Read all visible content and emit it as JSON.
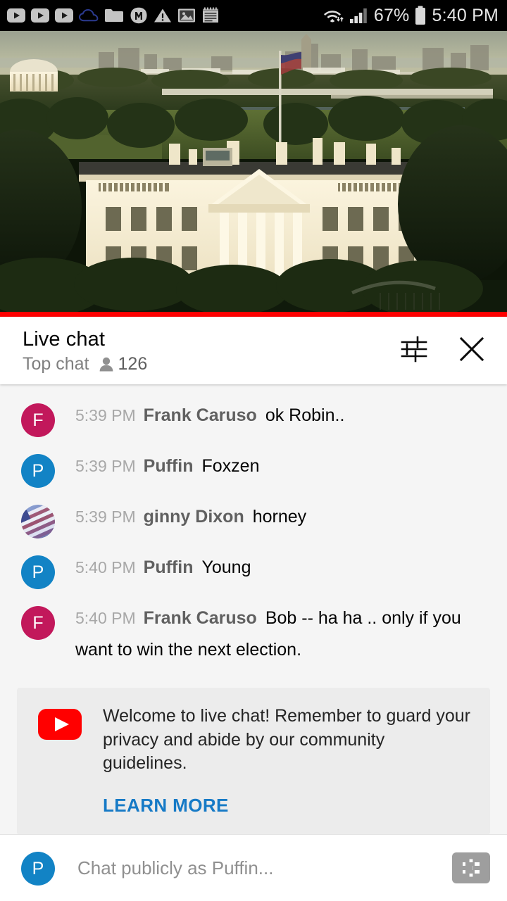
{
  "statusbar": {
    "left_icons": [
      "youtube-play-icon",
      "youtube-play-icon",
      "youtube-play-icon",
      "cloud-icon",
      "folder-icon",
      "monument-m-icon",
      "warning-triangle-icon",
      "image-icon",
      "notepad-icon"
    ],
    "wifi_icon": "wifi-icon",
    "signal_icon": "cellular-signal-icon",
    "battery_percent": "67%",
    "battery_icon": "battery-icon",
    "clock": "5:40 PM"
  },
  "video": {
    "alt": "White House with Washington DC skyline at sunset",
    "progress_percent": 100
  },
  "chat_header": {
    "title": "Live chat",
    "mode": "Top chat",
    "viewer_icon": "person-icon",
    "viewer_count": "126",
    "tune_button": "chat-settings-icon",
    "close_button": "close-icon"
  },
  "messages": [
    {
      "time": "5:39 PM",
      "author": "Frank Caruso",
      "text": "ok Robin..",
      "avatar_type": "letter",
      "avatar_letter": "F",
      "avatar_color": "#c2185b"
    },
    {
      "time": "5:39 PM",
      "author": "Puffin",
      "text": "Foxzen",
      "avatar_type": "letter",
      "avatar_letter": "P",
      "avatar_color": "#1283c5"
    },
    {
      "time": "5:39 PM",
      "author": "ginny Dixon",
      "text": "horney",
      "avatar_type": "photo",
      "avatar_letter": "",
      "avatar_color": "#6d7ab4"
    },
    {
      "time": "5:40 PM",
      "author": "Puffin",
      "text": "Young",
      "avatar_type": "letter",
      "avatar_letter": "P",
      "avatar_color": "#1283c5"
    },
    {
      "time": "5:40 PM",
      "author": "Frank Caruso",
      "text": "Bob -- ha ha .. only if you want to win the next election.",
      "avatar_type": "letter",
      "avatar_letter": "F",
      "avatar_color": "#c2185b"
    }
  ],
  "banner": {
    "icon": "youtube-logo-icon",
    "text": "Welcome to live chat! Remember to guard your privacy and abide by our community guidelines.",
    "link_label": "LEARN MORE",
    "link_color": "#167ac6"
  },
  "input_bar": {
    "avatar_letter": "P",
    "avatar_color": "#1283c5",
    "placeholder": "Chat publicly as Puffin...",
    "superchat_icon": "money-dollar-icon"
  },
  "colors": {
    "youtube_red": "#ff0000",
    "progress_red": "#e62117",
    "chat_bg": "#f5f5f5",
    "banner_bg": "#ececec"
  }
}
